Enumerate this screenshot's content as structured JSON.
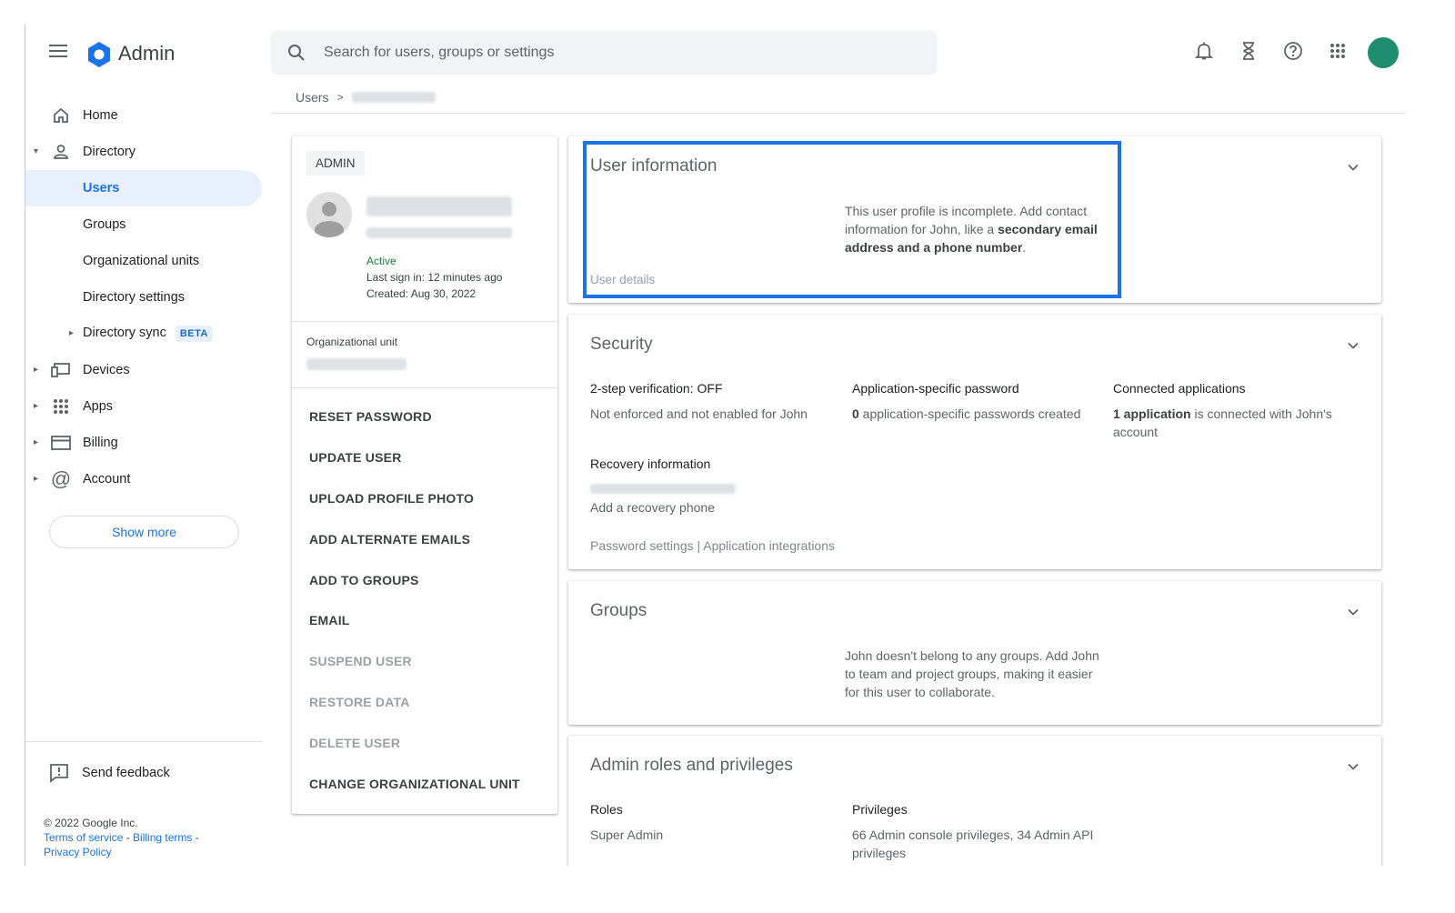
{
  "app": {
    "title": "Admin"
  },
  "search": {
    "placeholder": "Search for users, groups or settings"
  },
  "topbar": {
    "icons": [
      "bell-icon",
      "hourglass-icon",
      "help-icon",
      "apps-grid-icon"
    ]
  },
  "sidebar": {
    "items": [
      {
        "label": "Home",
        "icon": "home-icon"
      },
      {
        "label": "Directory",
        "icon": "person-icon",
        "expanded": true
      },
      {
        "label": "Users",
        "active": true
      },
      {
        "label": "Groups"
      },
      {
        "label": "Organizational units"
      },
      {
        "label": "Directory settings"
      },
      {
        "label": "Directory sync",
        "badge": "BETA"
      },
      {
        "label": "Devices",
        "icon": "devices-icon"
      },
      {
        "label": "Apps",
        "icon": "apps-icon"
      },
      {
        "label": "Billing",
        "icon": "billing-icon"
      },
      {
        "label": "Account",
        "icon": "at-icon"
      }
    ],
    "show_more": "Show more",
    "feedback": "Send feedback",
    "footer": {
      "copyright": "© 2022 Google Inc.",
      "terms": "Terms of service",
      "billing_terms": "Billing terms",
      "privacy": "Privacy Policy"
    }
  },
  "breadcrumb": {
    "root": "Users",
    "sep": ">"
  },
  "profile": {
    "role": "ADMIN",
    "status": "Active",
    "last_sign_in": "Last sign in: 12 minutes ago",
    "created": "Created: Aug 30, 2022",
    "ou_label": "Organizational unit",
    "actions": [
      {
        "label": "RESET PASSWORD",
        "enabled": true
      },
      {
        "label": "UPDATE USER",
        "enabled": true
      },
      {
        "label": "UPLOAD PROFILE PHOTO",
        "enabled": true
      },
      {
        "label": "ADD ALTERNATE EMAILS",
        "enabled": true
      },
      {
        "label": "ADD TO GROUPS",
        "enabled": true
      },
      {
        "label": "EMAIL",
        "enabled": true
      },
      {
        "label": "SUSPEND USER",
        "enabled": false
      },
      {
        "label": "RESTORE DATA",
        "enabled": false
      },
      {
        "label": "DELETE USER",
        "enabled": false
      },
      {
        "label": "CHANGE ORGANIZATIONAL UNIT",
        "enabled": true
      }
    ]
  },
  "user_info": {
    "title": "User information",
    "text_1": "This user profile is incomplete. Add contact information for John, like a ",
    "bold_1": "secondary email address and a phone number",
    "text_2": ".",
    "link": "User details"
  },
  "security": {
    "title": "Security",
    "two_step_label": "2-step verification: ",
    "two_step_value": "OFF",
    "two_step_desc": "Not enforced and not enabled for John",
    "app_pw_label": "Application-specific password",
    "app_pw_count": "0",
    "app_pw_desc": " application-specific passwords created",
    "connected_label": "Connected applications",
    "connected_count": "1 application",
    "connected_desc": " is connected with John's account",
    "recovery_label": "Recovery information",
    "recovery_phone": "Add a recovery phone",
    "links": "Password settings | Application integrations"
  },
  "groups": {
    "title": "Groups",
    "text": "John doesn't belong to any groups. Add John to team and project groups, making it easier for this user to collaborate."
  },
  "admin_roles": {
    "title": "Admin roles and privileges",
    "roles_label": "Roles",
    "roles_value": "Super Admin",
    "privileges_label": "Privileges",
    "privileges_value": "66 Admin console privileges, 34 Admin API privileges"
  },
  "colors": {
    "accent": "#1a73e8",
    "active_bg": "#e8f0fe",
    "status_active": "#188038",
    "avatar": "#1e8e6e"
  }
}
